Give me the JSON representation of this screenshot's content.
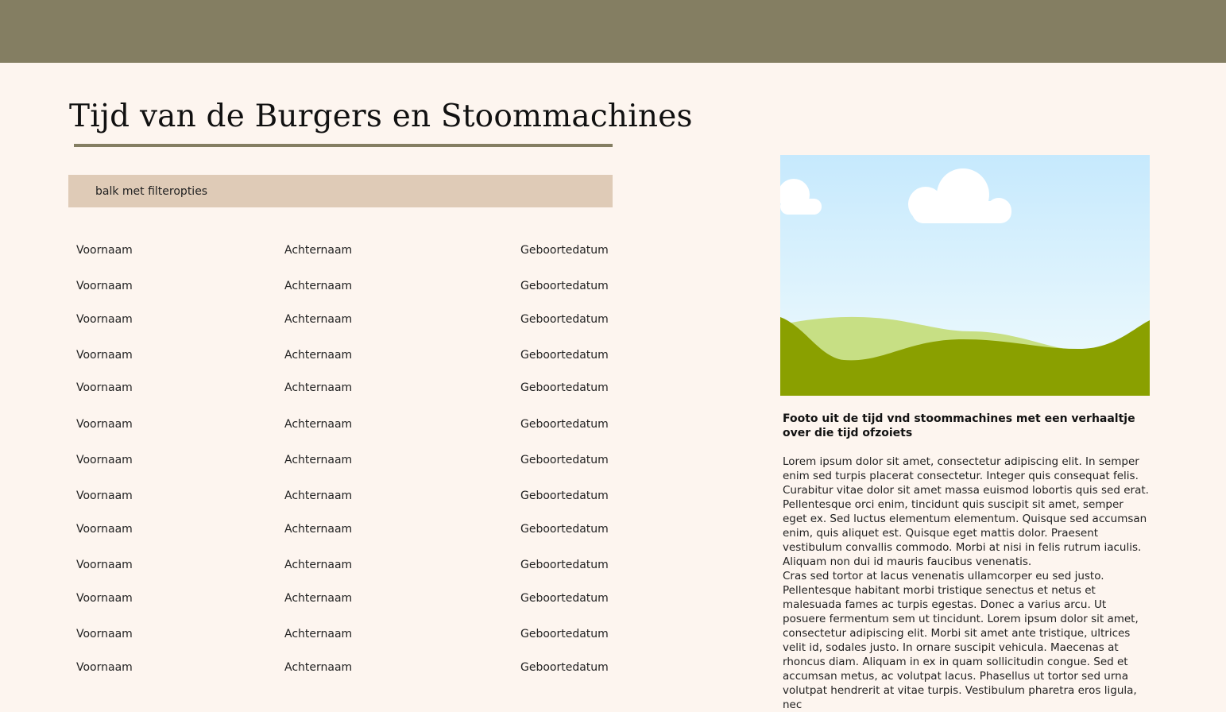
{
  "page": {
    "title": "Tijd van de Burgers en Stoommachines"
  },
  "filter_bar": {
    "label": "balk met filteropties"
  },
  "people": [
    {
      "first": "Voornaam",
      "last": "Achternaam",
      "birth": "Geboortedatum"
    },
    {
      "first": "Voornaam",
      "last": "Achternaam",
      "birth": "Geboortedatum"
    },
    {
      "first": "Voornaam",
      "last": "Achternaam",
      "birth": "Geboortedatum"
    },
    {
      "first": "Voornaam",
      "last": "Achternaam",
      "birth": "Geboortedatum"
    },
    {
      "first": "Voornaam",
      "last": "Achternaam",
      "birth": "Geboortedatum"
    },
    {
      "first": "Voornaam",
      "last": "Achternaam",
      "birth": "Geboortedatum"
    },
    {
      "first": "Voornaam",
      "last": "Achternaam",
      "birth": "Geboortedatum"
    },
    {
      "first": "Voornaam",
      "last": "Achternaam",
      "birth": "Geboortedatum"
    },
    {
      "first": "Voornaam",
      "last": "Achternaam",
      "birth": "Geboortedatum"
    },
    {
      "first": "Voornaam",
      "last": "Achternaam",
      "birth": "Geboortedatum"
    },
    {
      "first": "Voornaam",
      "last": "Achternaam",
      "birth": "Geboortedatum"
    },
    {
      "first": "Voornaam",
      "last": "Achternaam",
      "birth": "Geboortedatum"
    },
    {
      "first": "Voornaam",
      "last": "Achternaam",
      "birth": "Geboortedatum"
    }
  ],
  "aside": {
    "image_icon": "landscape-placeholder-icon",
    "caption": "Footo uit de tijd vnd stoommachines met een verhaaltje over die tijd ofzoiets",
    "paragraphs": [
      "Lorem ipsum dolor sit amet, consectetur adipiscing elit. In semper enim sed turpis placerat consectetur. Integer quis consequat felis. Curabitur vitae dolor sit amet massa euismod lobortis quis sed erat. Pellentesque orci enim, tincidunt quis suscipit sit amet, semper eget ex. Sed luctus elementum elementum. Quisque sed accumsan enim, quis aliquet est. Quisque eget mattis dolor. Praesent vestibulum convallis commodo. Morbi at nisi in felis rutrum iaculis. Aliquam non dui id mauris faucibus venenatis.",
      "Cras sed tortor at lacus venenatis ullamcorper eu sed justo. Pellentesque habitant morbi tristique senectus et netus et malesuada fames ac turpis egestas. Donec a varius arcu. Ut posuere fermentum sem ut tincidunt. Lorem ipsum dolor sit amet, consectetur adipiscing elit. Morbi sit amet ante tristique, ultrices velit id, sodales justo. In ornare suscipit vehicula. Maecenas at rhoncus diam. Aliquam in ex in quam sollicitudin congue. Sed et accumsan metus, ac volutpat lacus. Phasellus ut tortor sed urna volutpat hendrerit at vitae turpis. Vestibulum pharetra eros ligula, nec"
    ]
  },
  "colors": {
    "header": "#847e62",
    "background": "#fdf5ef",
    "filter_bar": "#dfcbb7",
    "sky_top": "#c6e9fd",
    "hill_light": "#c7df84",
    "hill_dark": "#8aa000"
  }
}
